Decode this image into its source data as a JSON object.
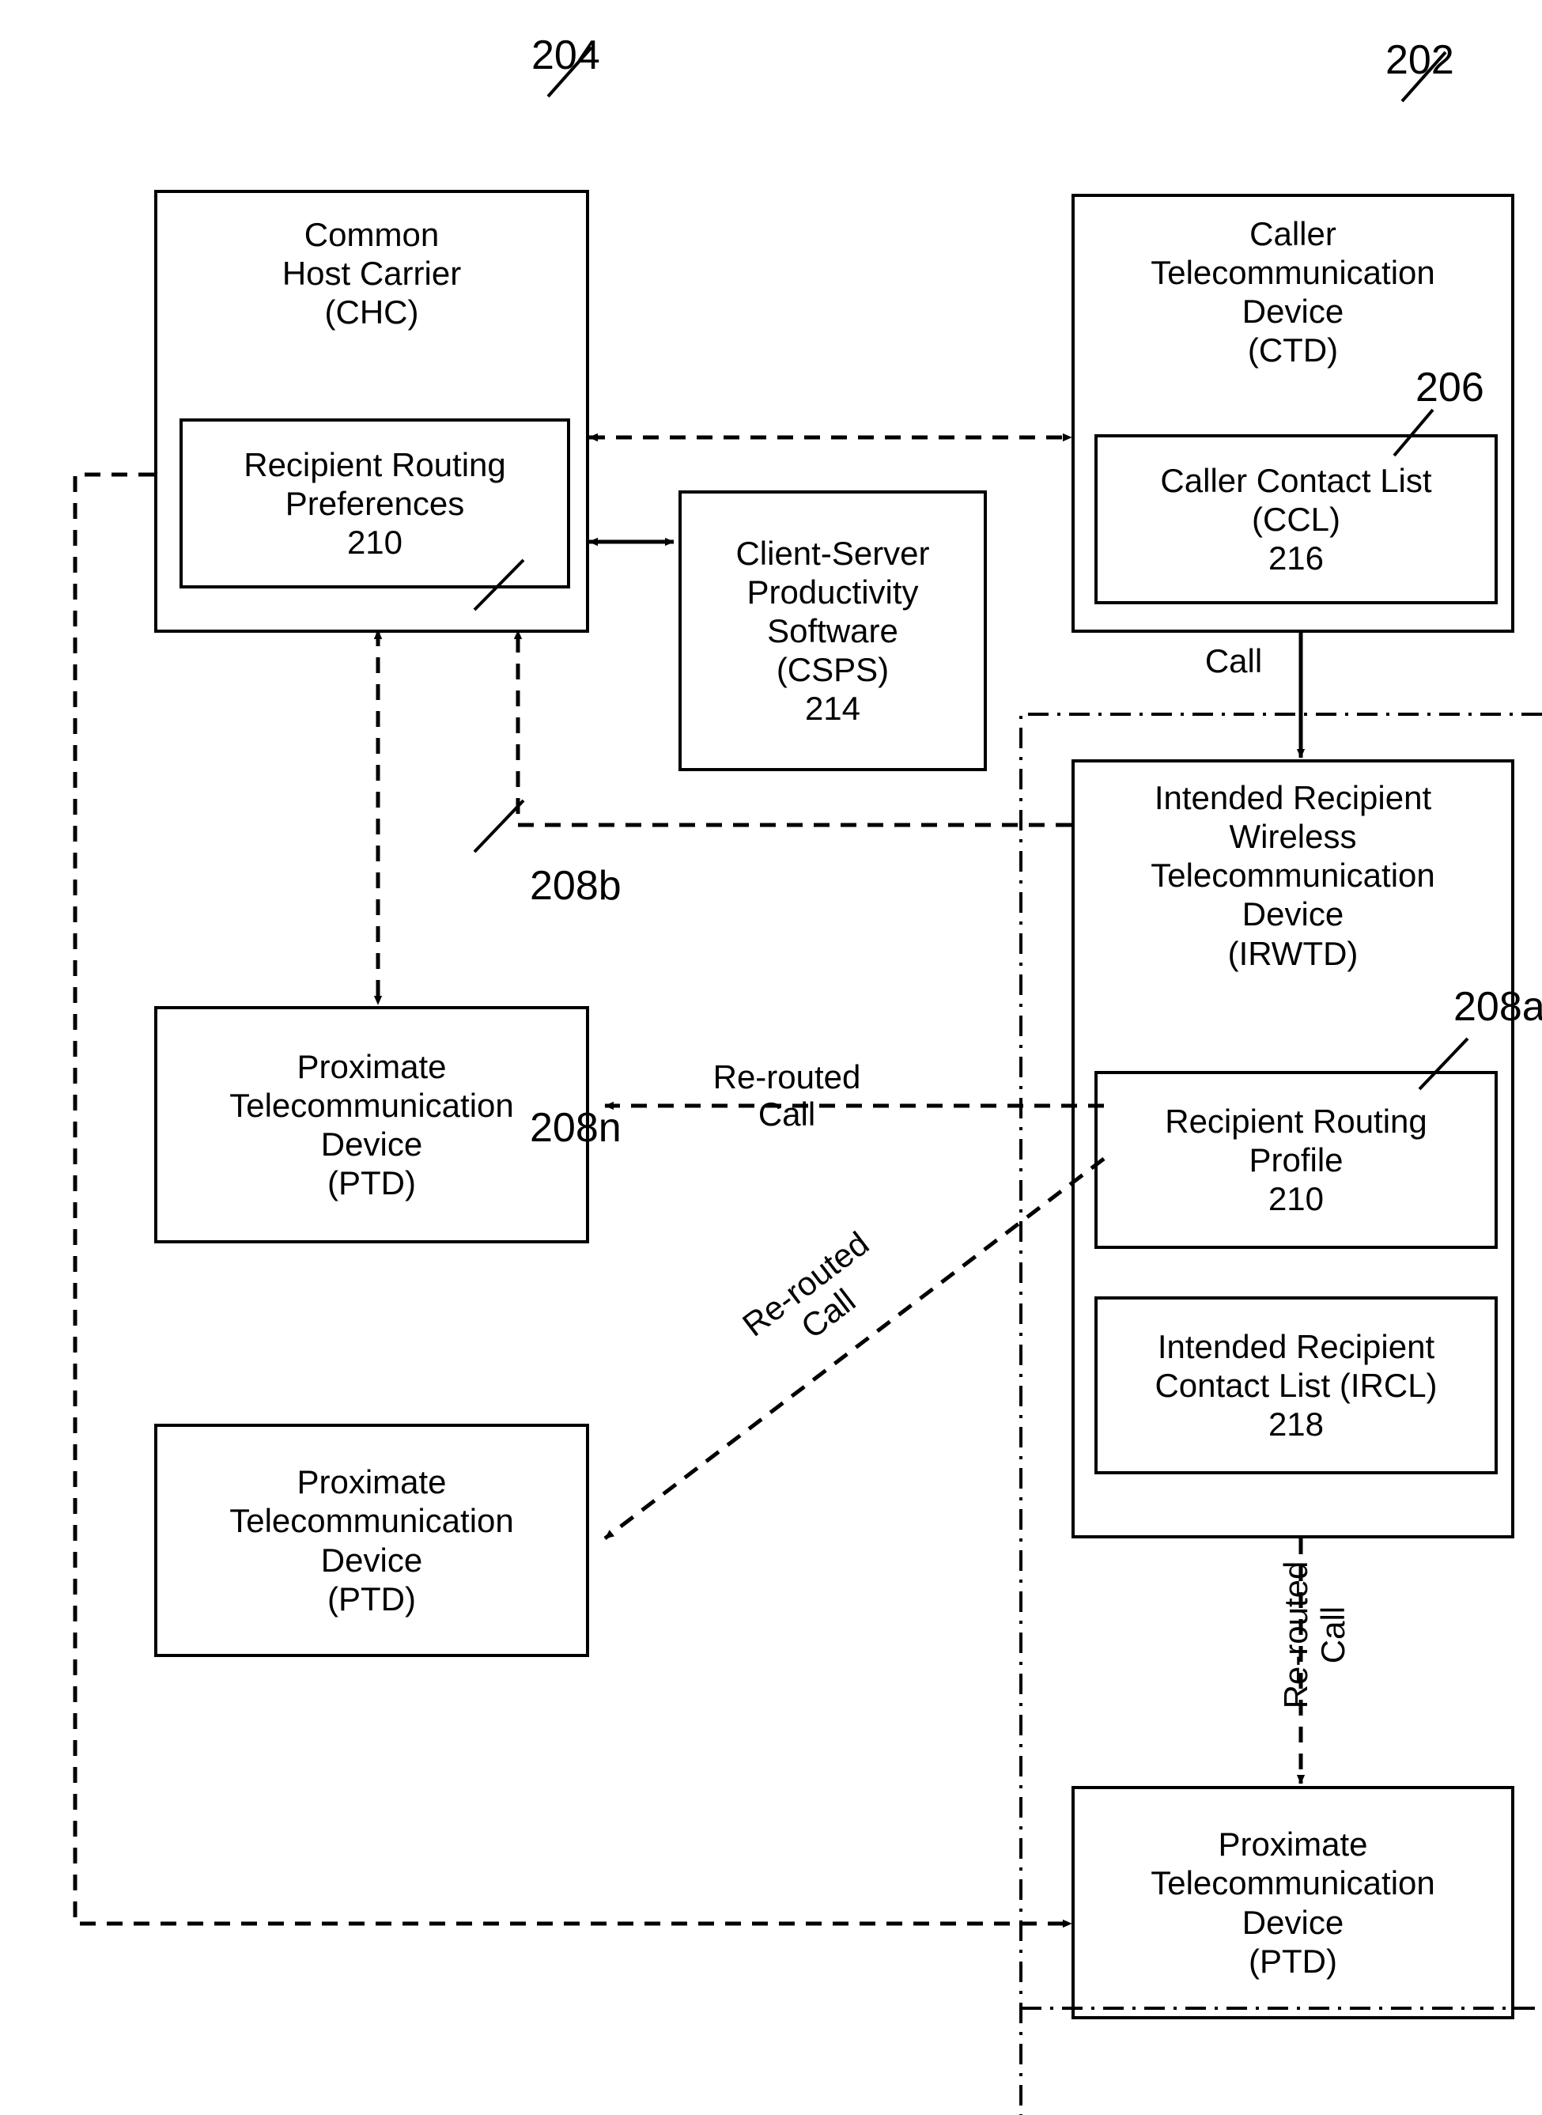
{
  "figure": {
    "type": "patent-block-diagram",
    "background": "#ffffff",
    "ink": "#000000"
  },
  "reference_tags": {
    "chc": "204",
    "ctd": "202",
    "boundary": "206",
    "ptd_b": "208b",
    "ptd_n": "208n",
    "ptd_a": "208a"
  },
  "blocks": {
    "chc": {
      "lines": [
        "Common",
        "Host Carrier",
        "(CHC)"
      ],
      "inner": {
        "lines": [
          "Recipient Routing",
          "Preferences",
          "210"
        ]
      }
    },
    "csps": {
      "lines": [
        "Client-Server",
        "Productivity",
        "Software",
        "(CSPS)",
        "214"
      ]
    },
    "ctd": {
      "lines": [
        "Caller",
        "Telecommunication",
        "Device",
        "(CTD)"
      ],
      "inner": {
        "lines": [
          "Caller Contact List",
          "(CCL)",
          "216"
        ]
      }
    },
    "irwtd": {
      "lines": [
        "Intended Recipient",
        "Wireless",
        "Telecommunication",
        "Device",
        "(IRWTD)"
      ],
      "inner_profile": {
        "lines": [
          "Recipient Routing",
          "Profile",
          "210"
        ]
      },
      "inner_ircl": {
        "lines": [
          "Intended Recipient",
          "Contact List (IRCL)",
          "218"
        ]
      }
    },
    "ptd_b": {
      "lines": [
        "Proximate",
        "Telecommunication",
        "Device",
        "(PTD)"
      ]
    },
    "ptd_n": {
      "lines": [
        "Proximate",
        "Telecommunication",
        "Device",
        "(PTD)"
      ]
    },
    "ptd_a": {
      "lines": [
        "Proximate",
        "Telecommunication",
        "Device",
        "(PTD)"
      ]
    }
  },
  "edge_labels": {
    "call": "Call",
    "rerouted_call_to_ptd_b": "Re-routed\nCall",
    "rerouted_call_to_ptd_n": "Re-routed\nCall",
    "rerouted_call_to_ptd_a": "Re-routed\nCall"
  }
}
